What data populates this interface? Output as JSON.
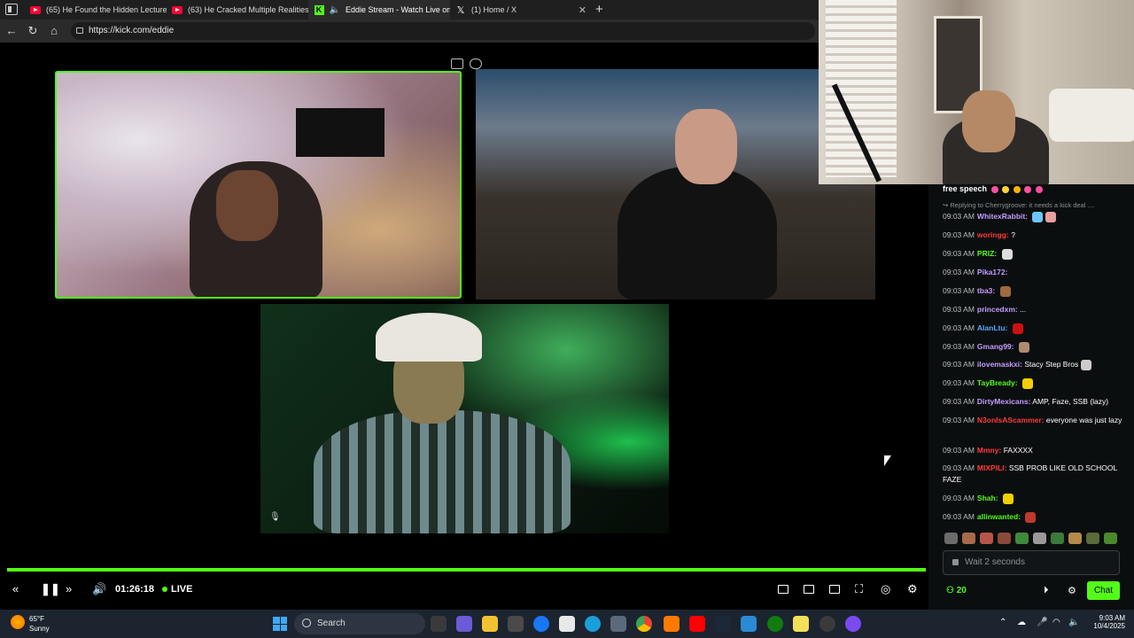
{
  "browser": {
    "tabs": [
      {
        "label": "(65) He Found the Hidden Lecture",
        "icon": "youtube-icon"
      },
      {
        "label": "(63) He Cracked Multiple Realities",
        "icon": "youtube-icon"
      },
      {
        "label": "Eddie Stream - Watch Live on",
        "icon": "kick-icon",
        "active": true
      },
      {
        "label": "(1) Home / X",
        "icon": "x-icon"
      }
    ],
    "url": "https://kick.com/eddie"
  },
  "player": {
    "time": "01:26:18",
    "live_label": "LIVE",
    "progress": 1.0
  },
  "chat": {
    "pinned": "free speech",
    "reply_line": "Replying to Cherrygroove: it needs a kick deal ....",
    "messages": [
      {
        "time": "09:03 AM",
        "user": "WhitexRabbit:",
        "color": "#c79bff",
        "text": "",
        "emotes": [
          "#6ec6ff",
          "#e8a0a0"
        ]
      },
      {
        "time": "09:03 AM",
        "user": "woringg:",
        "color": "#ff3b3b",
        "text": "?",
        "emotes": []
      },
      {
        "time": "09:03 AM",
        "user": "PRIZ:",
        "color": "#53fc18",
        "text": "",
        "emotes": [
          "#dddddd"
        ]
      },
      {
        "time": "09:03 AM",
        "user": "Pika172:",
        "color": "#c79bff",
        "text": "",
        "emotes": []
      },
      {
        "time": "09:03 AM",
        "user": "tba3:",
        "color": "#c79bff",
        "text": "",
        "emotes": [
          "#a06a3c"
        ]
      },
      {
        "time": "09:03 AM",
        "user": "princedxm:",
        "color": "#c79bff",
        "text": "...",
        "emotes": []
      },
      {
        "time": "09:03 AM",
        "user": "AlanLtu:",
        "color": "#57a8ff",
        "text": "",
        "emotes": [
          "#cc1111"
        ]
      },
      {
        "time": "09:03 AM",
        "user": "Gmang99:",
        "color": "#c79bff",
        "text": "",
        "emotes": [
          "#b08a70"
        ]
      },
      {
        "time": "09:03 AM",
        "user": "ilovemaskxi:",
        "color": "#c79bff",
        "text": "Stacy Step Bros",
        "emotes": [
          "#cccccc"
        ]
      },
      {
        "time": "09:03 AM",
        "user": "TayBready:",
        "color": "#53fc18",
        "text": "",
        "emotes": [
          "#f2d000"
        ]
      },
      {
        "time": "09:03 AM",
        "user": "DirtyMexicans:",
        "color": "#c79bff",
        "text": "AMP, Faze, SSB (lazy)",
        "emotes": []
      },
      {
        "time": "09:03 AM",
        "user": "N3onIsAScammer:",
        "color": "#ff3b3b",
        "text": "everyone was just lazy",
        "emotes": []
      },
      {
        "time": "09:03 AM",
        "user": "Mmny:",
        "color": "#ff3b3b",
        "text": "FAXXXX",
        "emotes": []
      },
      {
        "time": "09:03 AM",
        "user": "MIXPILI:",
        "color": "#ff3b3b",
        "text": "SSB PROB LIKE OLD SCHOOL FAZE",
        "emotes": []
      },
      {
        "time": "09:03 AM",
        "user": "Shah:",
        "color": "#53fc18",
        "text": "",
        "emotes": [
          "#f2d000"
        ]
      },
      {
        "time": "09:03 AM",
        "user": "allinwanted:",
        "color": "#53fc18",
        "text": "",
        "emotes": [
          "#c0392b"
        ]
      }
    ],
    "input_placeholder": "Wait 2 seconds",
    "viewers": "20",
    "chat_button": "Chat"
  },
  "taskbar": {
    "temperature": "65°F",
    "condition": "Sunny",
    "search_label": "Search",
    "time": "9:03 AM",
    "date": "10/4/2025"
  },
  "colors": {
    "accent": "#53fc18",
    "chat_bg": "#0b0e0f",
    "taskbar_bg": "#1c2430"
  }
}
